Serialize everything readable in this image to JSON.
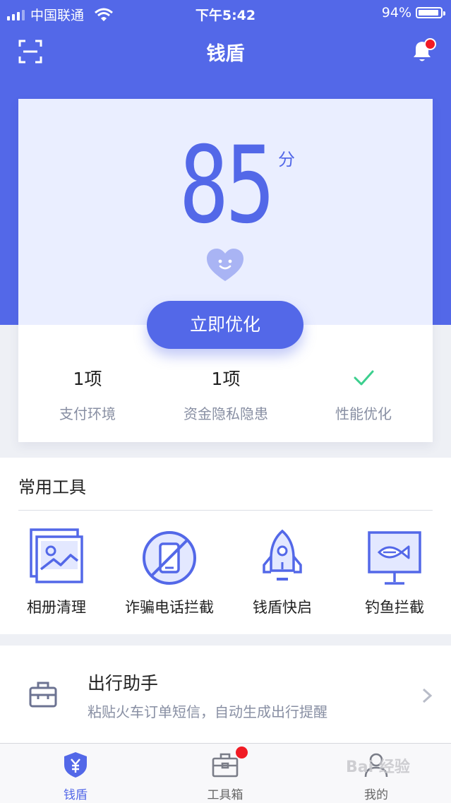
{
  "status_bar": {
    "carrier": "中国联通",
    "time": "下午5:42",
    "battery": "94%",
    "battery_level": 0.94
  },
  "header": {
    "title": "钱盾",
    "scan_icon": "scan-icon",
    "bell_icon": "bell-icon",
    "has_notification": true
  },
  "score": {
    "value": "85",
    "unit": "分",
    "mood_icon": "heart-smile-icon",
    "optimize_label": "立即优化",
    "stats": [
      {
        "value": "1项",
        "label": "支付环境"
      },
      {
        "value": "1项",
        "label": "资金隐私隐患"
      },
      {
        "value": "",
        "icon": "check-icon",
        "label": "性能优化"
      }
    ]
  },
  "tools": {
    "title": "常用工具",
    "items": [
      {
        "label": "相册清理",
        "icon": "photo-album-icon"
      },
      {
        "label": "诈骗电话拦截",
        "icon": "blocked-phone-icon"
      },
      {
        "label": "钱盾快启",
        "icon": "rocket-icon"
      },
      {
        "label": "钓鱼拦截",
        "icon": "fish-monitor-icon"
      }
    ]
  },
  "assistant": {
    "title": "出行助手",
    "subtitle": "粘贴火车订单短信，自动生成出行提醒",
    "icon": "suitcase-icon"
  },
  "tabbar": {
    "items": [
      {
        "label": "钱盾",
        "icon": "shield-yen-icon",
        "active": true
      },
      {
        "label": "工具箱",
        "icon": "toolbox-icon",
        "badge": true
      },
      {
        "label": "我的",
        "icon": "user-icon"
      }
    ]
  },
  "watermark": "Bai 经验",
  "colors": {
    "brand": "#5368e8",
    "card_tint": "#eaeeff",
    "success": "#3ccf8e",
    "badge": "#f11b24",
    "muted_text": "#888fa3"
  }
}
